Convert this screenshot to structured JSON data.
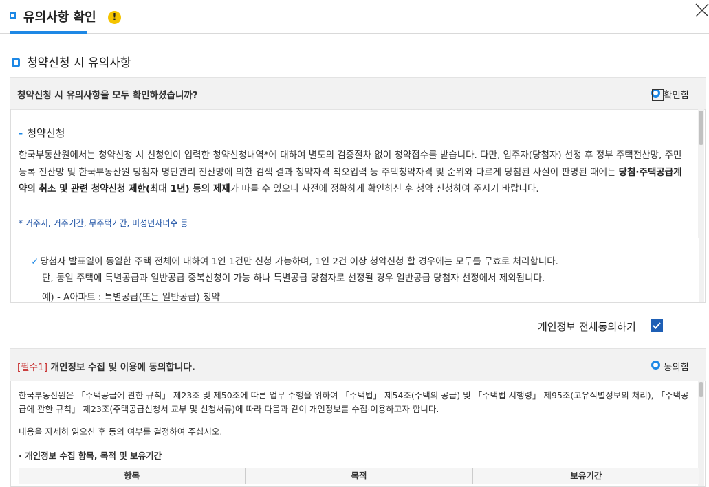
{
  "header": {
    "title": "유의사항 확인",
    "warning_glyph": "!",
    "accent_color": "#1e88e5"
  },
  "section": {
    "title": "청약신청 시 유의사항"
  },
  "confirm_bar": {
    "question": "청약신청 시 유의사항을 모두 확인하셨습니까?",
    "check_label": "확인함"
  },
  "notice": {
    "subtitle": "청약신청",
    "para_intro": "한국부동산원에서는 청약신청 시 신청인이 입력한 청약신청내역*에 대하여 별도의 검증절차 없이 청약접수를 받습니다. 다만, 입주자(당첨자) 선정 후 정부 주택전산망, 주민등록 전산망 및 한국부동산원 당첨자 명단관리 전산망에 의한 검색 결과 청약자격 착오입력 등 주택청약자격 및 순위와 다르게 당첨된 사실이 판명된 때에는 ",
    "para_bold": "당첨·주택공급계약의 취소 및 관련 청약신청 제한(최대 1년) 등의 제재",
    "para_end": "가 따를 수 있으니 사전에 정확하게 확인하신 후 청약 신청하여 주시기 바랍니다.",
    "footnote": "* 거주지, 거주기간, 무주택기간, 미성년자녀수 등",
    "check_mark": "✓",
    "rule_line1": "당첨자 발표일이 동일한 주택 전체에 대하여 1인 1건만 신청 가능하며, 1인 2건 이상 청약신청 할 경우에는 모두를 무효로 처리합니다.",
    "rule_line2": "단, 동일 주택에 특별공급과 일반공급 중복신청이 가능 하나 특별공급 당첨자로 선정될 경우 일반공급 당첨자 선정에서 제외됩니다.",
    "rule_line3": "예)  -  A아파트 : 특별공급(또는 일반공급) 청약"
  },
  "agree_all": {
    "label": "개인정보 전체동의하기",
    "checked": true
  },
  "consent_bar": {
    "required_tag": "[필수1]",
    "text": " 개인정보 수집 및 이용에 동의합니다.",
    "radio_label": "동의함"
  },
  "consent_body": {
    "para": "한국부동산원은 「주택공급에 관한 규칙」 제23조 및 제50조에 따른 업무 수행을 위하여 「주택법」 제54조(주택의 공급) 및 「주택법 시행령」 제95조(고유식별정보의 처리), 「주택공급에 관한 규칙」 제23조(주택공급신청서 교부 및 신청서류)에 따라 다음과 같이 개인정보를 수집·이용하고자 합니다.",
    "note": "내용을 자세히 읽으신 후 동의 여부를 결정하여 주십시오.",
    "items_title": "· 개인정보 수집 항목, 목적 및 보유기간",
    "table_headers": [
      "항목",
      "목적",
      "보유기간"
    ]
  }
}
